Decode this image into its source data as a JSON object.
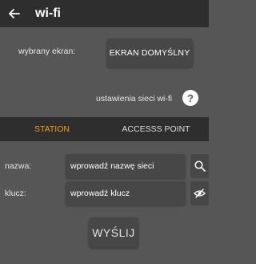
{
  "header": {
    "title": "wi-fi",
    "back_icon": "arrow-left-icon"
  },
  "screen": {
    "label": "wybrany ekran:",
    "button_label": "EKRAN DOMYŚLNY"
  },
  "wifi": {
    "label": "ustawienia sieci wi-fi",
    "help_label": "?"
  },
  "tabs": [
    {
      "label": "STATION",
      "active": true
    },
    {
      "label": "ACCESSS POINT",
      "active": false
    }
  ],
  "fields": {
    "name": {
      "label": "nazwa:",
      "placeholder": "wprowadź nazwę sieci",
      "icon": "search-icon"
    },
    "key": {
      "label": "klucz:",
      "placeholder": "wprowadź klucz",
      "icon": "eye-off-icon"
    }
  },
  "send_label": "WYŚLIJ",
  "colors": {
    "background": "#565656",
    "header": "#2e2e2e",
    "button": "#474747",
    "accent": "#f39c12"
  }
}
